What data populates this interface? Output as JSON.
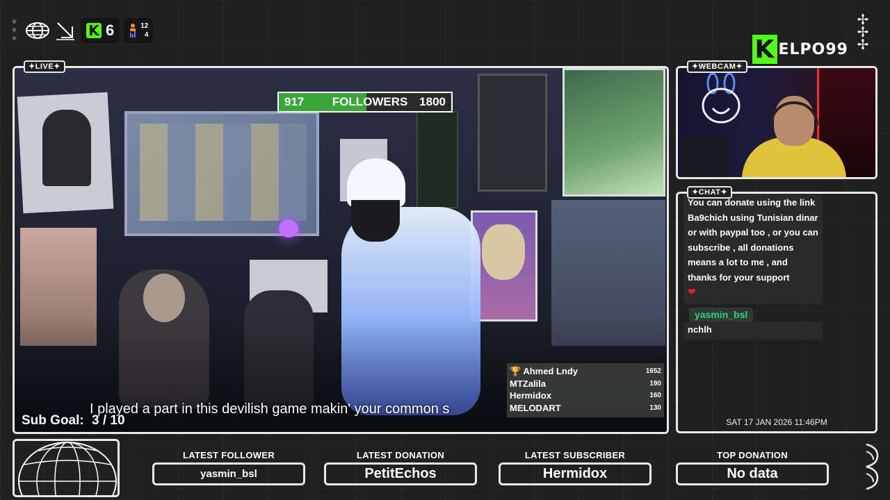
{
  "header": {
    "kick_count": "6",
    "stat_top": "12",
    "stat_bottom": "4"
  },
  "brand": {
    "logo_letter": "K",
    "name": "ELPO99"
  },
  "live": {
    "tag": "✦LIVE✦",
    "followers": {
      "current": "917",
      "label": "FOLLOWERS",
      "goal": "1800",
      "progress": 0.51
    },
    "caption": "I played a part in this devilish game makin' your common s",
    "sub_goal_label": "Sub Goal:",
    "sub_goal_value": "3 / 10",
    "leaderboard": [
      {
        "name": "🏆 Ahmed Lndy",
        "value": "1652"
      },
      {
        "name": "MTZalila",
        "value": "190"
      },
      {
        "name": "Hermidox",
        "value": "160"
      },
      {
        "name": "MELODART",
        "value": "130"
      }
    ]
  },
  "webcam": {
    "tag": "✦WEBCAM✦"
  },
  "chat": {
    "tag": "✦CHAT✦",
    "message1": "You can donate using the link Ba9chich using Tunisian dinar or with paypal too , or you can subscribe , all donations means a lot to me , and thanks for your support",
    "heart": "❤",
    "username": "yasmin_bsl",
    "message2": "nchlh",
    "datetime": "SAT 17 JAN 2026 11:46PM"
  },
  "bottom": {
    "latest_follower_label": "LATEST FOLLOWER",
    "latest_follower": "yasmin_bsl",
    "latest_donation_label": "LATEST DONATION",
    "latest_donation": "PetitEchos",
    "latest_subscriber_label": "LATEST SUBSCRIBER",
    "latest_subscriber": "Hermidox",
    "top_donation_label": "TOP DONATION",
    "top_donation": "No data"
  },
  "colors": {
    "kick_green": "#53fc18",
    "follow_bar": "#3aa63a",
    "chat_user": "#32d17a",
    "border": "#e8e8e8"
  }
}
